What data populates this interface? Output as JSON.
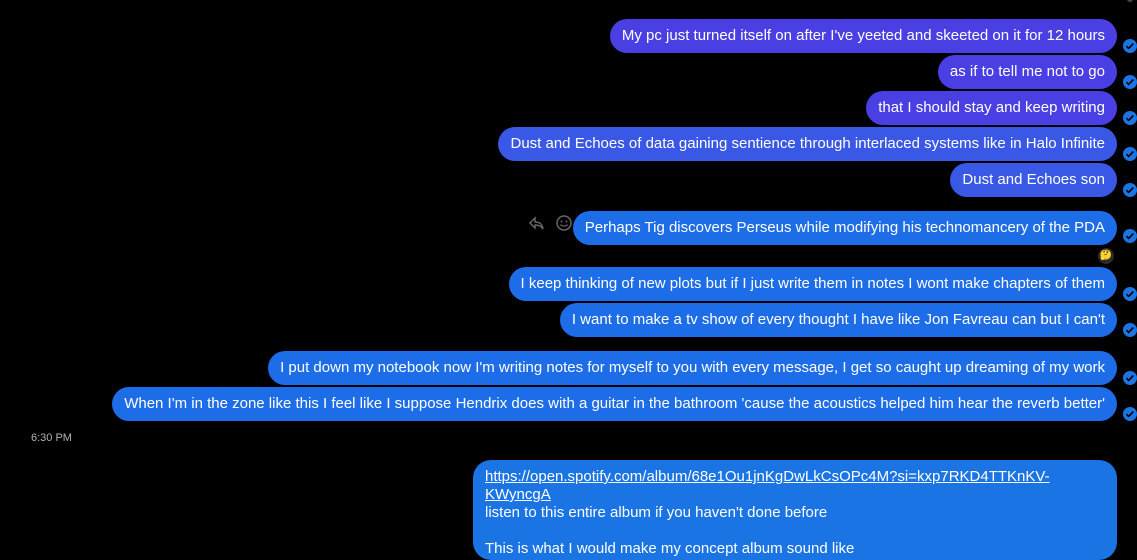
{
  "messages": [
    {
      "text": "My pc just turned itself on after I've yeeted and skeeted on it for 12 hours"
    },
    {
      "text": "as if to tell me not to go"
    },
    {
      "text": "that I should stay and keep writing"
    },
    {
      "text": "Dust and Echoes of data gaining sentience through interlaced systems like in Halo Infinite"
    },
    {
      "text": "Dust and Echoes son"
    },
    {
      "text": "Perhaps Tig discovers Perseus while modifying his technomancery of the PDA"
    },
    {
      "text": "I keep thinking of new plots but if I just write them in notes I wont make chapters of them"
    },
    {
      "text": "I want to make a tv show of every thought I have like Jon Favreau can but I can't"
    },
    {
      "text": "I put down my notebook now I'm writing notes for myself to you with every message, I get so caught up dreaming of my work"
    },
    {
      "text": "When I'm in the zone like this I feel like I suppose Hendrix does with a guitar in the bathroom 'cause the acoustics helped him hear the reverb better'"
    }
  ],
  "timestamp": "6:30 PM",
  "last_message": {
    "link": "https://open.spotify.com/album/68e1Ou1jnKgDwLkCsOPc4M?si=kxp7RKD4TTKnKV-KWyncgA",
    "line1": " listen to this entire album if you haven't done before",
    "line2": "This is what I would make my concept album sound like"
  },
  "reaction": "🤔",
  "colors": {
    "bubble_purple": "#4a3fe3",
    "bubble_blue": "#1e6de8",
    "link_bubble": "#1b74e4",
    "background": "#000000"
  },
  "icons": [
    "reply-icon",
    "emoji-react-icon",
    "delivered-check-icon"
  ]
}
